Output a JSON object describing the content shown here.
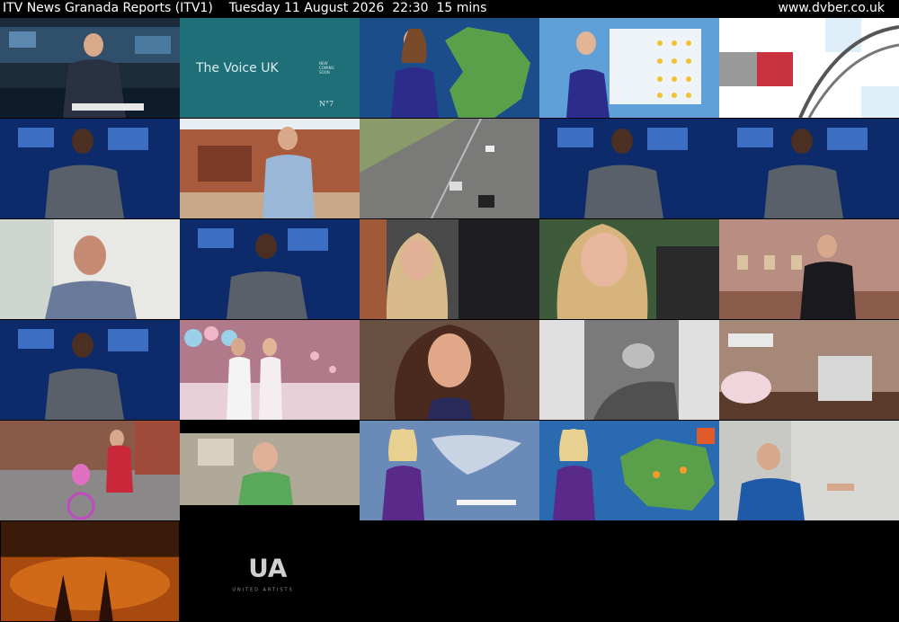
{
  "header": {
    "title": "ITV News Granada Reports (ITV1)    Tuesday 11 August 2026  22:30  15 mins",
    "site": "www.dvber.co.uk"
  },
  "thumbnails": {
    "t01": "",
    "t02": "The Voice UK",
    "t02_small": "NEW\nCOMING\nSOON",
    "t02_brand": "N°7",
    "t05": "",
    "t28_logo": "UA",
    "t28_text": "UNITED ARTISTS"
  },
  "colors": {
    "studio_blue": "#0d2a6b",
    "weather_green": "#3a8f3a",
    "voice_teal": "#1f6f78"
  }
}
